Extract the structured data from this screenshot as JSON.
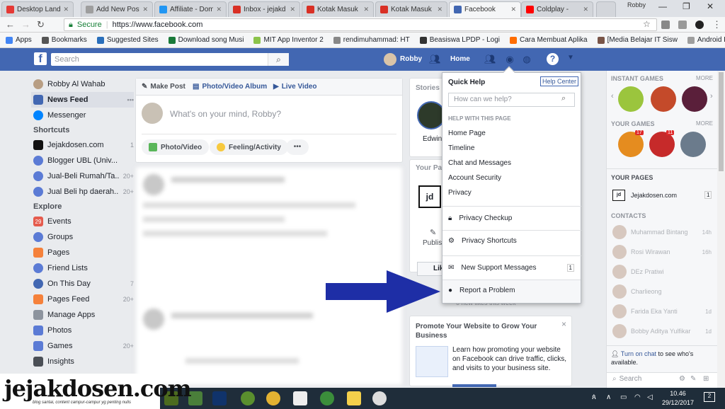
{
  "browser": {
    "tabs": [
      {
        "label": "Desktop Landi",
        "color": "#e53935",
        "active": false
      },
      {
        "label": "Add New Post",
        "color": "#9e9e9e",
        "active": false
      },
      {
        "label": "Affiliate - Dom",
        "color": "#2196f3",
        "active": false
      },
      {
        "label": "Inbox - jejakd",
        "color": "#d93025",
        "active": false
      },
      {
        "label": "Kotak Masuk (",
        "color": "#d93025",
        "active": false
      },
      {
        "label": "Kotak Masuk (",
        "color": "#d93025",
        "active": false
      },
      {
        "label": "Facebook",
        "color": "#4267b2",
        "active": true
      },
      {
        "label": "Coldplay - ",
        "color": "#ff0000",
        "active": false
      }
    ],
    "profile_name": "Robby",
    "secure_label": "Secure",
    "url": "https://www.facebook.com",
    "bookmarks": [
      {
        "label": "Apps",
        "color": "#4285f4"
      },
      {
        "label": "Bookmarks",
        "color": "#555555"
      },
      {
        "label": "Suggested Sites",
        "color": "#2a6fbb"
      },
      {
        "label": "Download song Musi",
        "color": "#1a7a3a"
      },
      {
        "label": "MIT App Inventor 2",
        "color": "#8bc34a"
      },
      {
        "label": "rendimuhammad: HT",
        "color": "#888888"
      },
      {
        "label": "Beasiswa LPDP - Logi",
        "color": "#333333"
      },
      {
        "label": "Cara Membuat Aplika",
        "color": "#ff6d00"
      },
      {
        "label": "[Media Belajar IT Sisw",
        "color": "#795548"
      },
      {
        "label": "Android Indonesia: A",
        "color": "#9e9e9e"
      }
    ]
  },
  "fb": {
    "search_placeholder": "Search",
    "user_name": "Robby",
    "home_label": "Home",
    "left_nav": {
      "profile": "Robby Al Wahab",
      "main": [
        {
          "label": "News Feed",
          "selected": true,
          "color": "#4267b2",
          "more": "•••"
        },
        {
          "label": "Messenger",
          "selected": false,
          "color": "#0084ff"
        }
      ],
      "shortcuts_title": "Shortcuts",
      "shortcuts": [
        {
          "label": "Jejakdosen.com",
          "count": "1",
          "color": "#111111"
        },
        {
          "label": "Blogger UBL (Univ...",
          "count": "",
          "color": "#5b7bd5"
        },
        {
          "label": "Jual-Beli Rumah/Ta...",
          "count": "20+",
          "color": "#5b7bd5"
        },
        {
          "label": "Jual Beli hp daerah...",
          "count": "20+",
          "color": "#5b7bd5"
        }
      ],
      "explore_title": "Explore",
      "explore": [
        {
          "label": "Events",
          "count": "",
          "color": "#e55b4d",
          "glyph": "29"
        },
        {
          "label": "Groups",
          "count": "",
          "color": "#5b7bd5",
          "glyph": ""
        },
        {
          "label": "Pages",
          "count": "",
          "color": "#f5813b",
          "glyph": ""
        },
        {
          "label": "Friend Lists",
          "count": "",
          "color": "#5b7bd5",
          "glyph": ""
        },
        {
          "label": "On This Day",
          "count": "7",
          "color": "#4267b2",
          "glyph": ""
        },
        {
          "label": "Pages Feed",
          "count": "20+",
          "color": "#f5813b",
          "glyph": ""
        },
        {
          "label": "Manage Apps",
          "count": "",
          "color": "#8d949e",
          "glyph": ""
        },
        {
          "label": "Photos",
          "count": "",
          "color": "#5b7bd5",
          "glyph": ""
        },
        {
          "label": "Games",
          "count": "20+",
          "color": "#5b7bd5",
          "glyph": ""
        },
        {
          "label": "Insights",
          "count": "",
          "color": "#4b4f56",
          "glyph": ""
        }
      ]
    },
    "composer": {
      "tab_post": "Make Post",
      "tab_album": "Photo/Video Album",
      "tab_live": "Live Video",
      "placeholder": "What's on your mind, Robby?",
      "btn_photo": "Photo/Video",
      "btn_feeling": "Feeling/Activity",
      "btn_more": "•••"
    },
    "middle": {
      "stories_title": "Stories",
      "stories_name": "Edwin",
      "your_pages_title": "Your Pa",
      "publish_label": "Publis",
      "like_label": "Lik",
      "likes_week": "0 new likes this week",
      "promo_title": "Promote Your Website to Grow Your Business",
      "promo_text": "Learn how promoting your website on Facebook can drive traffic, clicks, and visits to your business site.",
      "promo_close": "×"
    },
    "dropdown": {
      "title": "Quick Help",
      "help_center": "Help Center",
      "search_placeholder": "How can we help?",
      "section_title": "HELP WITH THIS PAGE",
      "items": [
        "Home Page",
        "Timeline",
        "Chat and Messages",
        "Account Security",
        "Privacy"
      ],
      "privacy_checkup": "Privacy Checkup",
      "privacy_shortcuts": "Privacy Shortcuts",
      "support_messages": "New Support Messages",
      "support_count": "1",
      "report_problem": "Report a Problem"
    },
    "right": {
      "instant_games": "INSTANT GAMES",
      "more1": "MORE",
      "your_games": "YOUR GAMES",
      "more2": "MORE",
      "game_badges": [
        "17",
        "11",
        ""
      ],
      "your_pages": "YOUR PAGES",
      "page_name": "Jejakdosen.com",
      "page_count": "1",
      "contacts_title": "CONTACTS",
      "contacts": [
        {
          "name": "Muhammad Bintang",
          "time": "14h"
        },
        {
          "name": "Rosi Wirawan",
          "time": "16h"
        },
        {
          "name": "DEz Pratiwi",
          "time": ""
        },
        {
          "name": "Charlieong",
          "time": ""
        },
        {
          "name": "Farida Eka Yanti",
          "time": "1d"
        },
        {
          "name": "Bobby Aditya Yulfikar",
          "time": "1d"
        }
      ],
      "chat_link": "Turn on chat",
      "chat_text": " to see who's available.",
      "chat_search": "Search"
    }
  },
  "taskbar": {
    "time": "10.46",
    "date": "29/12/2017",
    "notif_count": "2"
  },
  "watermark": {
    "title": "jejakdosen.com",
    "subtitle": "blog santai, content campur-campur yg penting nulis"
  }
}
